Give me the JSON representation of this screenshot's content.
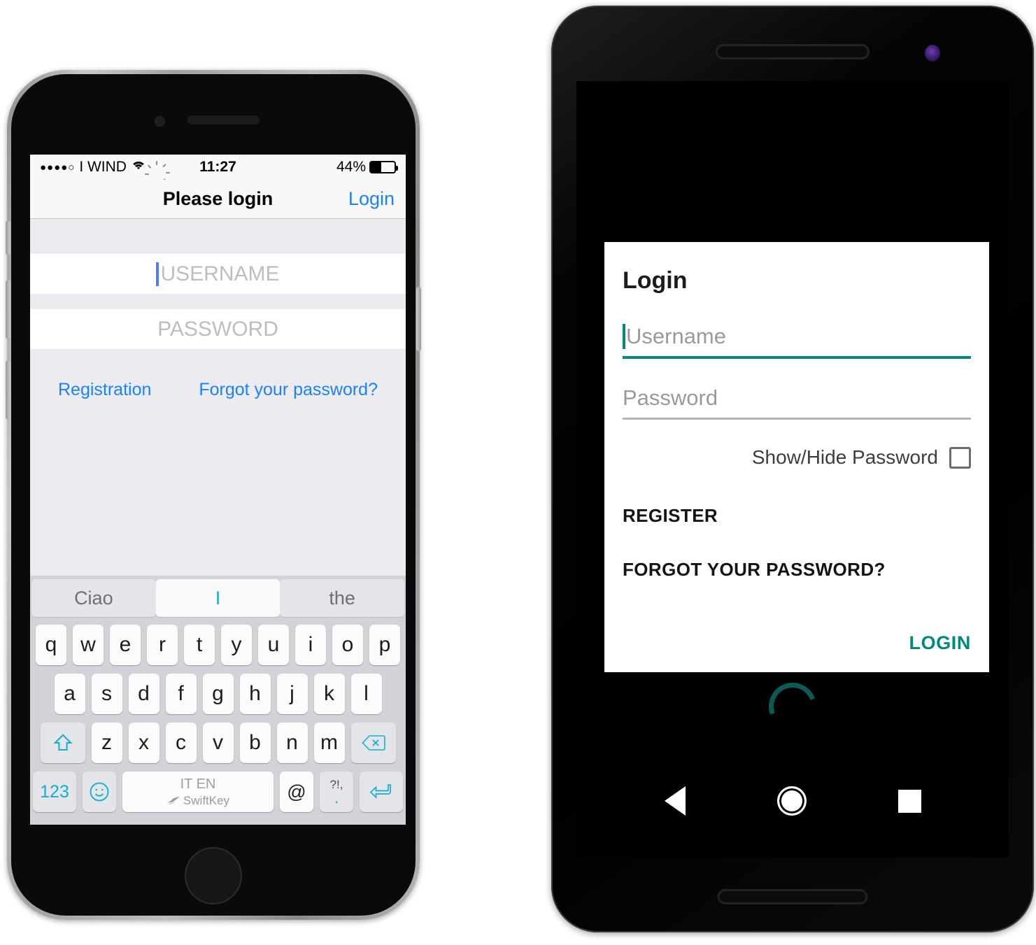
{
  "ios": {
    "status_bar": {
      "signal_dots": "●●●●○",
      "carrier": "I WIND",
      "wifi_icon": "wifi-icon",
      "activity_icon": "activity-spinner-icon",
      "time": "11:27",
      "battery_percent": "44%",
      "battery_level": 44
    },
    "nav": {
      "title": "Please login",
      "action": "Login"
    },
    "form": {
      "username_placeholder": "USERNAME",
      "password_placeholder": "PASSWORD",
      "registration_link": "Registration",
      "forgot_link": "Forgot your password?"
    },
    "keyboard": {
      "predictions": [
        "Ciao",
        "I",
        "the"
      ],
      "row1": [
        "q",
        "w",
        "e",
        "r",
        "t",
        "y",
        "u",
        "i",
        "o",
        "p"
      ],
      "row2": [
        "a",
        "s",
        "d",
        "f",
        "g",
        "h",
        "j",
        "k",
        "l"
      ],
      "row3": [
        "z",
        "x",
        "c",
        "v",
        "b",
        "n",
        "m"
      ],
      "shift_icon": "shift-arrow-icon",
      "backspace_icon": "backspace-icon",
      "numeric_key": "123",
      "emoji_icon": "smiley-icon",
      "space_language": "IT EN",
      "space_brand": "SwiftKey",
      "at_key": "@",
      "punct_top": "?!,",
      "punct_bottom": ".",
      "return_icon": "return-arrow-icon"
    }
  },
  "android": {
    "dialog": {
      "title": "Login",
      "username_placeholder": "Username",
      "password_placeholder": "Password",
      "show_hide_label": "Show/Hide Password",
      "checkbox_checked": false,
      "register_label": "REGISTER",
      "forgot_label": "FORGOT YOUR PASSWORD?",
      "login_label": "LOGIN"
    },
    "nav": {
      "back_icon": "back-triangle-icon",
      "home_icon": "home-circle-icon",
      "recents_icon": "recents-square-icon"
    },
    "spinner_icon": "loading-spinner-icon"
  },
  "colors": {
    "ios_accent": "#1a82ff",
    "ios_caret": "#4a7dff",
    "android_accent": "#00897b",
    "keyboard_accent": "#14aed0",
    "ios_bg": "#ebebf0"
  }
}
